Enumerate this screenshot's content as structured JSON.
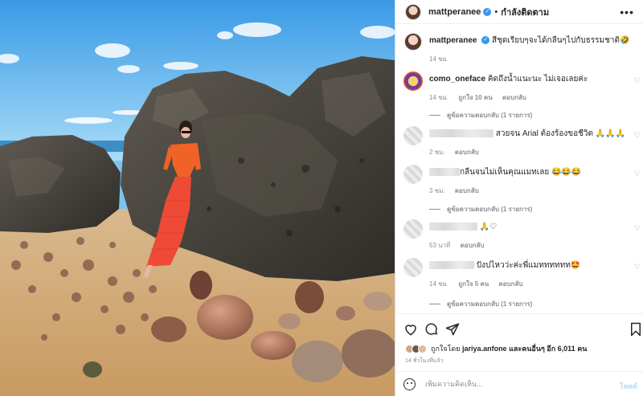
{
  "header": {
    "username": "mattperanee",
    "following_label": "กำลังติดตาม",
    "more_icon": "more-icon"
  },
  "caption": {
    "username": "mattperanee",
    "text": "สีชุดเรียบๆจะได้กลืนๆไปกับธรรมชาติ🤣",
    "time": "14 ชม."
  },
  "comments": [
    {
      "username": "como_oneface",
      "text": "คิดถึงน้ำแนะนะ ไม่เจอเลยค่ะ",
      "time": "14 ชม.",
      "likes": "ถูกใจ 10 คน",
      "reply": "ตอบกลับ",
      "view_replies": "ดูข้อความตอบกลับ (1 รายการ)"
    },
    {
      "text": "สวยจน Arial ต้องร้องขอชีวิต 🙏🙏🙏",
      "time": "2 ชม.",
      "reply": "ตอบกลับ"
    },
    {
      "text": "กลืนจนไม่เห็นคุณแมทเลย 😂😂😂",
      "time": "3 ชม.",
      "reply": "ตอบกลับ",
      "view_replies": "ดูข้อความตอบกลับ (1 รายการ)"
    },
    {
      "text": "🙏♡",
      "time": "53 นาที",
      "reply": "ตอบกลับ"
    },
    {
      "text": "ปังปไหวว่ะค่ะพี่แมทททททท🤩",
      "time": "14 ชม.",
      "likes": "ถูกใจ 5 คน",
      "reply": "ตอบกลับ",
      "view_replies": "ดูข้อความตอบกลับ (1 รายการ)"
    }
  ],
  "likes": {
    "liked_by_prefix": "ถูกใจโดย",
    "liked_by_user": "jariya.anfone",
    "and_others": "และคนอื่นๆ อีก 6,011 คน"
  },
  "posted_time": "14 ชั่วโมงที่แล้ว",
  "comment_box": {
    "placeholder": "เพิ่มความคิดเห็น...",
    "post_label": "โพสต์"
  },
  "colors": {
    "verified": "#3897f0",
    "post_disabled": "#b2dffc",
    "muted": "#8e8e8e"
  }
}
